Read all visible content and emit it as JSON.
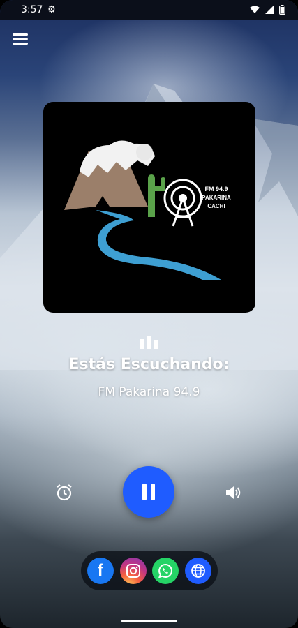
{
  "status_bar": {
    "time": "3:57"
  },
  "now_playing": {
    "title": "Estás Escuchando:",
    "station": "FM Pakarina 94.9"
  },
  "logo": {
    "line1": "FM 94.9",
    "line2": "PAKARINA",
    "line3": "CACHI"
  },
  "icons": {
    "menu": "hamburger-menu-icon",
    "alarm": "alarm-clock-icon",
    "play_state": "pause-icon",
    "volume": "volume-icon",
    "social": [
      "facebook-icon",
      "instagram-icon",
      "whatsapp-icon",
      "globe-icon"
    ]
  },
  "colors": {
    "accent": "#1f5cff",
    "facebook": "#1877f2",
    "whatsapp": "#25d366"
  },
  "social": {
    "facebook_glyph": "f"
  }
}
